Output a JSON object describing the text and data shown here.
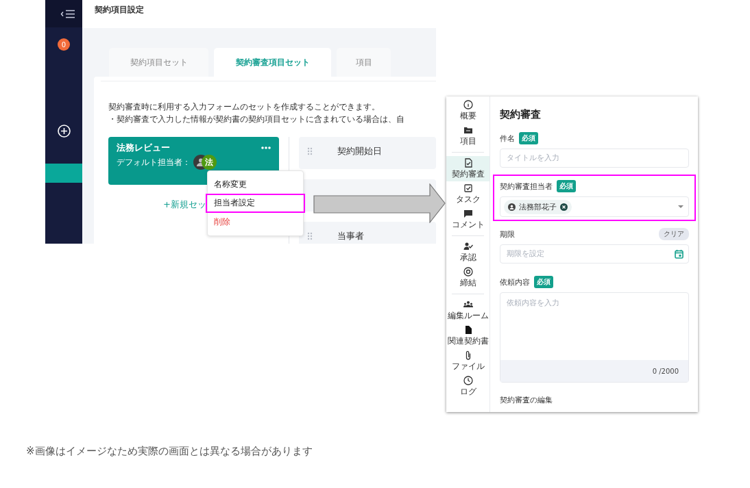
{
  "settings_screen": {
    "sidebar": {
      "badge": "0"
    },
    "header_title": "契約項目設定",
    "tabs": [
      {
        "label": "契約項目セット",
        "selected": false
      },
      {
        "label": "契約審査項目セット",
        "selected": true
      },
      {
        "label": "項目",
        "selected": false
      }
    ],
    "description": [
      "契約審査時に利用する入力フォームのセットを作成することができます。",
      "・契約審査で入力した情報が契約書の契約項目セットに含まれている場合は、自"
    ],
    "set_card": {
      "title": "法務レビュー",
      "default_assignee_label": "デフォルト担当者：",
      "avatar_text": "法"
    },
    "new_set_link": "+新規セッ",
    "context_menu": [
      {
        "label": "名称変更",
        "kind": "normal",
        "highlighted": false
      },
      {
        "label": "担当者設定",
        "kind": "normal",
        "highlighted": true
      },
      {
        "label": "削除",
        "kind": "danger",
        "highlighted": false
      }
    ],
    "fields": [
      {
        "kind": "label",
        "label": "契約開始日"
      },
      {
        "kind": "covered"
      },
      {
        "kind": "label",
        "label": "当事者"
      }
    ]
  },
  "review_panel": {
    "nav": [
      {
        "kind": "info",
        "label": "概要",
        "selected": false
      },
      {
        "kind": "folder",
        "label": "項目",
        "selected": false
      },
      {
        "kind": "divider"
      },
      {
        "kind": "review",
        "label": "契約審査",
        "selected": true
      },
      {
        "kind": "task",
        "label": "タスク",
        "selected": false
      },
      {
        "kind": "comment",
        "label": "コメント",
        "selected": false
      },
      {
        "kind": "divider"
      },
      {
        "kind": "approval",
        "label": "承認",
        "selected": false
      },
      {
        "kind": "target",
        "label": "締結",
        "selected": false
      },
      {
        "kind": "divider"
      },
      {
        "kind": "group",
        "label": "編集ルーム",
        "selected": false
      },
      {
        "kind": "document",
        "label": "関連契約書",
        "selected": false
      },
      {
        "kind": "clip",
        "label": "ファイル",
        "selected": false
      },
      {
        "kind": "clock",
        "label": "ログ",
        "selected": false
      }
    ],
    "title": "契約審査",
    "fields": [
      {
        "kind": "text",
        "label": "件名",
        "required_badge": "必須",
        "placeholder": "タイトルを入力",
        "highlighted": false
      },
      {
        "kind": "select",
        "label": "契約審査担当者",
        "required_badge": "必須",
        "chips": [
          "法務部花子"
        ],
        "highlighted": true
      },
      {
        "kind": "date",
        "label": "期限",
        "clear_button": "クリア",
        "placeholder": "期限を設定",
        "highlighted": false
      },
      {
        "kind": "textarea",
        "label": "依頼内容",
        "required_badge": "必須",
        "placeholder": "依頼内容を入力",
        "counter": "0 /2000",
        "highlighted": false
      },
      {
        "kind": "heading",
        "label": "契約審査の編集"
      }
    ]
  },
  "note": "※画像はイメージなため実際の画面とは異なる場合があります"
}
